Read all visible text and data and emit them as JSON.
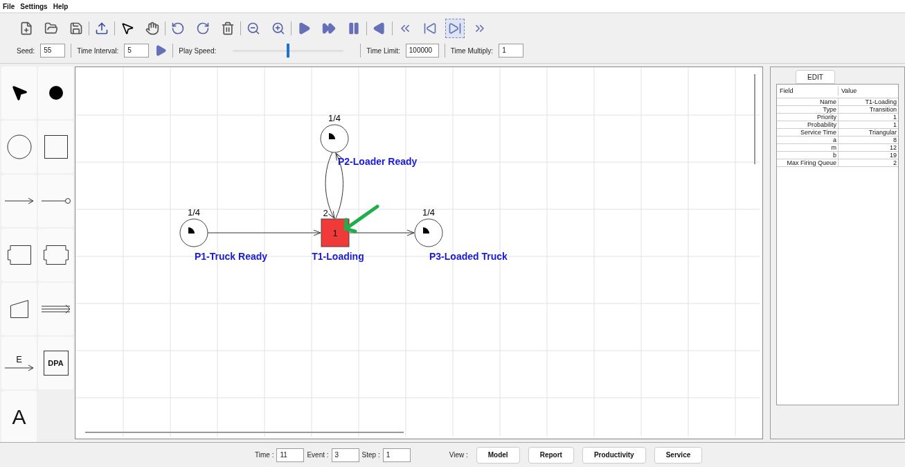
{
  "menu": [
    "File",
    "Settings",
    "Help"
  ],
  "toolbar": [
    [
      {
        "kind": "new",
        "selected": false
      },
      {
        "kind": "open",
        "selected": false
      },
      {
        "kind": "save",
        "selected": false
      }
    ],
    [
      {
        "kind": "upload",
        "selected": false
      }
    ],
    [
      {
        "kind": "pointer",
        "selected": false
      },
      {
        "kind": "hand",
        "selected": false
      }
    ],
    [
      {
        "kind": "undo",
        "selected": false
      },
      {
        "kind": "redo",
        "selected": false
      },
      {
        "kind": "trash",
        "selected": false
      }
    ],
    [
      {
        "kind": "zoom-out",
        "selected": false
      },
      {
        "kind": "zoom-in",
        "selected": false
      }
    ],
    [
      {
        "kind": "play",
        "selected": false
      },
      {
        "kind": "fast-forward",
        "selected": false
      },
      {
        "kind": "pause",
        "selected": false
      }
    ],
    [
      {
        "kind": "back",
        "selected": false
      }
    ],
    [
      {
        "kind": "rewind",
        "selected": false
      },
      {
        "kind": "step-back",
        "selected": false
      },
      {
        "kind": "step-forward",
        "selected": true
      },
      {
        "kind": "forward",
        "selected": false
      }
    ]
  ],
  "settings": {
    "seed_label": "Seed:",
    "seed": "55",
    "interval_label": "Time Interval:",
    "interval": "5",
    "speed_label": "Play Speed:",
    "speed": {
      "level": 0.5
    },
    "limit_label": "Time Limit:",
    "limit": "100000",
    "multiply_label": "Time Multiply:",
    "multiply": "1"
  },
  "palette": [
    {
      "kind": "pointer"
    },
    {
      "kind": "dot"
    },
    {
      "kind": "circle"
    },
    {
      "kind": "square"
    },
    {
      "kind": "arrow"
    },
    {
      "kind": "inhibitor"
    },
    {
      "kind": "shape-a"
    },
    {
      "kind": "shape-b"
    },
    {
      "kind": "trapezoid"
    },
    {
      "kind": "triple-arrow"
    },
    {
      "kind": "labeled-arrow",
      "text": "E"
    },
    {
      "kind": "boxed-text",
      "text": "DPA"
    },
    {
      "kind": "text-tool",
      "text": "A"
    }
  ],
  "diagram": {
    "places": [
      {
        "name": "P1-Truck Ready",
        "tokens": "1/4"
      },
      {
        "name": "P2-Loader Ready",
        "tokens": "1/4"
      },
      {
        "name": "P3-Loaded Truck",
        "tokens": "1/4"
      }
    ],
    "transition": {
      "name": "T1-Loading",
      "count": "2",
      "inside": "1",
      "color": "#f03a3a"
    }
  },
  "properties": {
    "edit_button": "EDIT",
    "columns": [
      "Field",
      "Value"
    ],
    "rows": [
      {
        "field": "Name",
        "value": "T1-Loading"
      },
      {
        "field": "Type",
        "value": "Transition"
      },
      {
        "field": "Priority",
        "value": "1"
      },
      {
        "field": "Probability",
        "value": "1"
      },
      {
        "field": "Service Time",
        "value": "Triangular"
      },
      {
        "field": "a",
        "value": "8"
      },
      {
        "field": "m",
        "value": "12"
      },
      {
        "field": "b",
        "value": "19"
      },
      {
        "field": "Max Firing Queue",
        "value": "2"
      }
    ]
  },
  "status": {
    "time_label": "Time :",
    "time": "11",
    "event_label": "Event :",
    "event": "3",
    "step_label": "Step :",
    "step": "1",
    "view_label": "View :",
    "views": [
      "Model",
      "Report",
      "Productivity",
      "Service"
    ]
  }
}
